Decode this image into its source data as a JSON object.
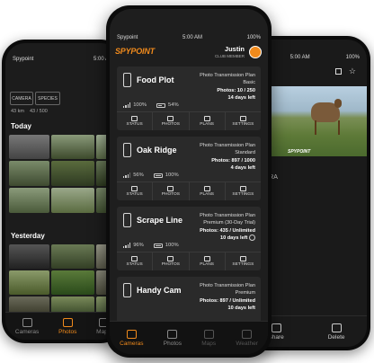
{
  "left_phone": {
    "status": {
      "carrier": "Spypoint",
      "time": "5:00 AM"
    },
    "filters": [
      "CAMERA",
      "SPECIES"
    ],
    "counts": {
      "photos": "43 km",
      "starred": "43 / 500"
    },
    "sections": [
      "Today",
      "Yesterday"
    ],
    "tabs": [
      "Cameras",
      "Photos",
      "Maps"
    ]
  },
  "center_phone": {
    "status": {
      "carrier": "Spypoint",
      "time": "5:00 AM",
      "battery": "100%"
    },
    "brand": "SPYPOINT",
    "user": {
      "name": "Justin",
      "role": "CLUB MEMBER"
    },
    "plan_label": "Photo Transmission Plan",
    "cameras": [
      {
        "name": "Food Plot",
        "plan": "Basic",
        "photos": "Photos: 10 / 250",
        "days": "14 days left",
        "signal": "100%",
        "battery": "54%"
      },
      {
        "name": "Oak Ridge",
        "plan": "Standard",
        "photos": "Photos: 897 / 1000",
        "days": "4 days left",
        "signal": "56%",
        "battery": "100%"
      },
      {
        "name": "Scrape Line",
        "plan": "Premium (30-Day Trial)",
        "photos": "Photos: 435 / Unlimited",
        "days": "10 days left",
        "signal": "96%",
        "battery": "100%"
      },
      {
        "name": "Handy Cam",
        "plan": "Premium",
        "photos": "Photos: 897 / Unlimited",
        "days": "10 days left",
        "signal": "",
        "battery": ""
      }
    ],
    "actions": [
      "STATUS",
      "PHOTOS",
      "PLANS",
      "SETTINGS"
    ],
    "tabs": [
      "Cameras",
      "Photos",
      "Maps",
      "Weather"
    ],
    "accent": "#f08a1c"
  },
  "right_phone": {
    "status": {
      "time": "5:00 AM",
      "battery": "100%"
    },
    "camera_label": "AMERA",
    "watermark": "SPYPOINT",
    "tabs": [
      "Share",
      "Delete"
    ]
  }
}
